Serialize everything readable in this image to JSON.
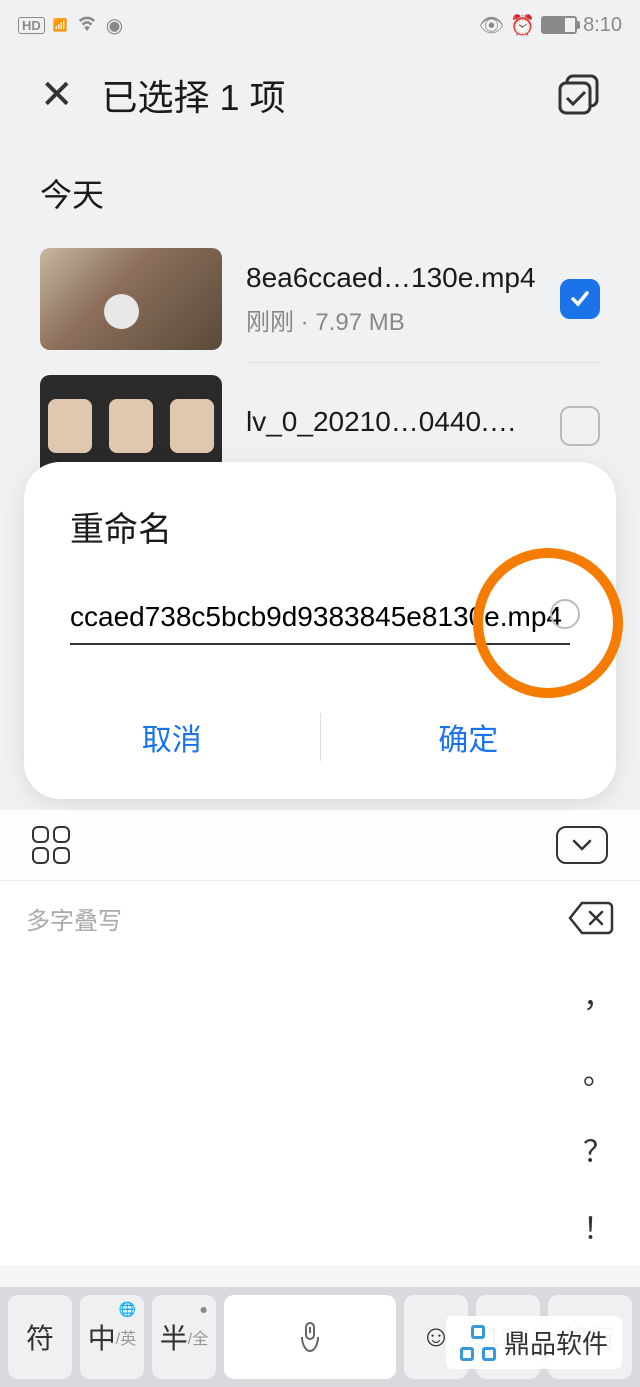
{
  "status": {
    "time": "8:10",
    "hd_label": "HD",
    "net_label": "4G"
  },
  "header": {
    "title": "已选择 1 项"
  },
  "section": {
    "today": "今天"
  },
  "files": [
    {
      "name": "8ea6ccaed…130e.mp4",
      "meta": "刚刚 · 7.97 MB",
      "checked": true
    },
    {
      "name": "lv_0_20210…0440.mp4",
      "meta": "",
      "checked": false
    }
  ],
  "dialog": {
    "title": "重命名",
    "input_value": "ccaed738c5bcb9d9383845e8130e.mp4",
    "cancel": "取消",
    "confirm": "确定"
  },
  "keyboard": {
    "suggest": "多字叠写",
    "side": [
      "，",
      "。",
      "？",
      "！"
    ],
    "keys": {
      "sym": "符",
      "cn": "中",
      "cn_sub": "/英",
      "half": "半",
      "half_sub": "/全",
      "num": "123",
      "enter": "换行"
    }
  },
  "watermark": "鼎品软件"
}
